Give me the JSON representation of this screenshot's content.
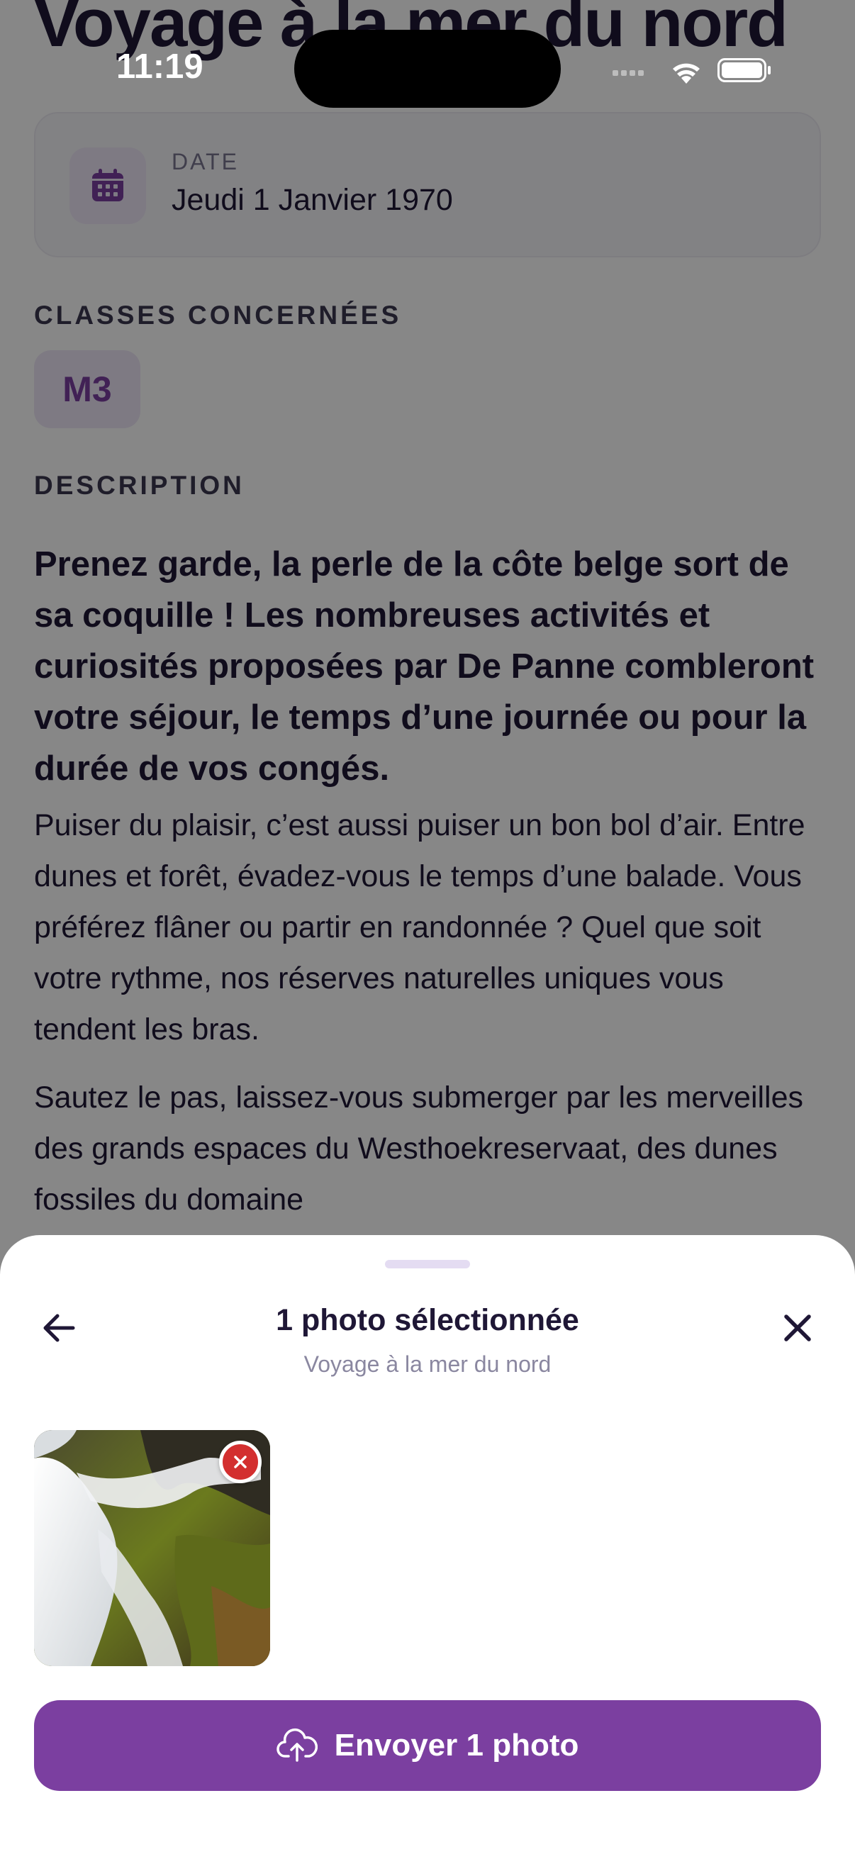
{
  "status_bar": {
    "time": "11:19"
  },
  "page": {
    "title": "Voyage à la mer du nord",
    "date": {
      "label": "DATE",
      "value": "Jeudi 1 Janvier 1970",
      "icon": "calendar-icon"
    },
    "classes": {
      "label": "CLASSES CONCERNÉES",
      "items": [
        "M3"
      ]
    },
    "description": {
      "label": "DESCRIPTION",
      "lead": "Prenez garde, la perle de la côte belge sort de sa coquille ! Les nombreuses activités et curiosités proposées par De Panne combleront votre séjour, le temps d’une journée ou pour la durée de vos congés.",
      "paragraphs": [
        "Puiser du plaisir, c’est aussi puiser un bon bol d’air. Entre dunes et forêt, évadez-vous le temps d’une balade. Vous préférez flâner ou partir en randonnée ? Quel que soit votre rythme, nos réserves naturelles uniques vous tendent les bras.",
        "Sautez le pas, laissez-vous submerger par les merveilles des grands espaces du Westhoekreservaat, des dunes fossiles du domaine"
      ]
    }
  },
  "sheet": {
    "title": "1 photo sélectionnée",
    "subtitle": "Voyage à la mer du nord",
    "back_icon": "arrow-left-icon",
    "close_icon": "close-icon",
    "photos": [
      {
        "description": "waterfall-thumbnail"
      }
    ],
    "send_label": "Envoyer 1 photo",
    "send_icon": "cloud-upload-icon"
  },
  "colors": {
    "accent": "#7b3fa0",
    "text_dark": "#1f1736",
    "remove_red": "#d32f2f",
    "chip_bg": "#eee7f7"
  }
}
